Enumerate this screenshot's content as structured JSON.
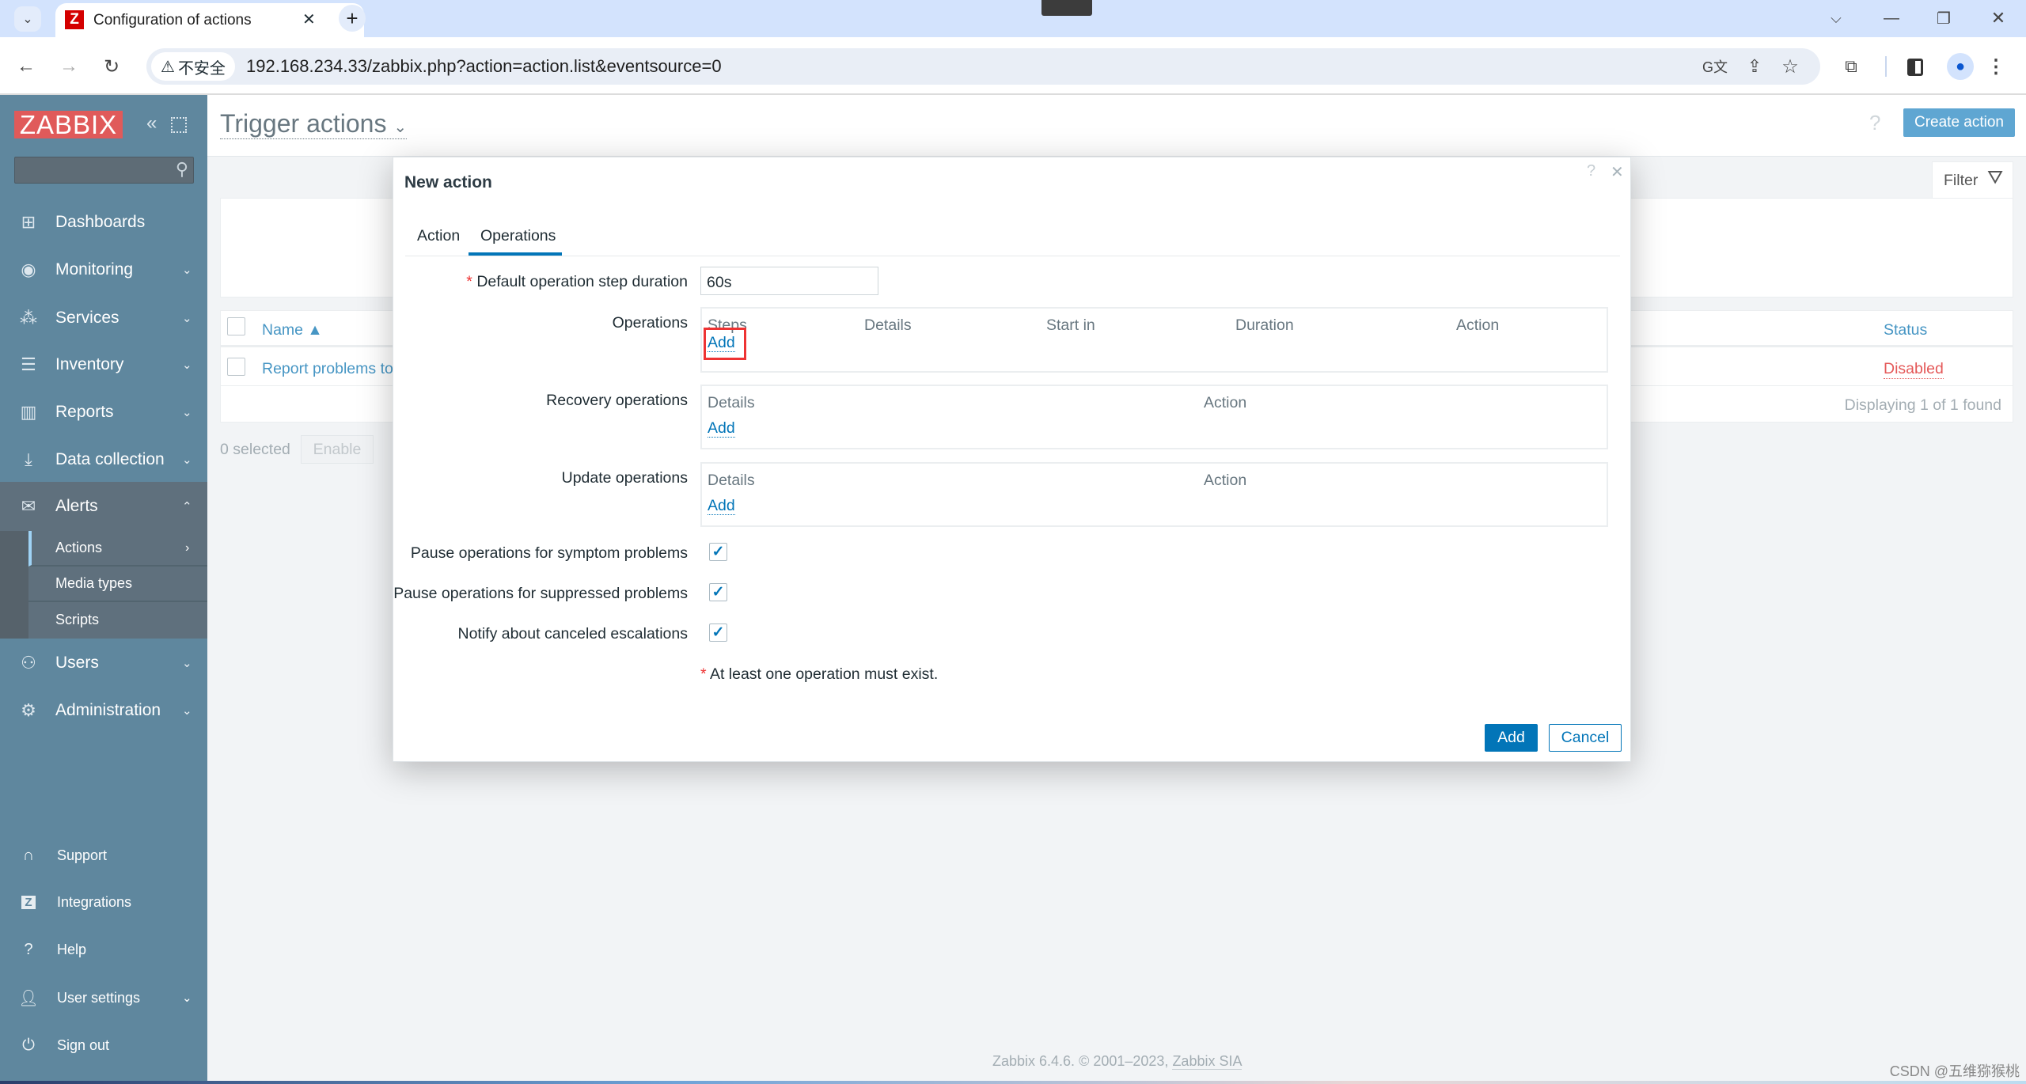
{
  "browser": {
    "tab_title": "Configuration of actions",
    "tab_favicon": "Z",
    "security_label": "不安全",
    "url": "192.168.234.33/zabbix.php?action=action.list&eventsource=0"
  },
  "sidebar": {
    "logo": "ZABBIX",
    "search_placeholder": "",
    "items": [
      {
        "label": "Dashboards",
        "icon": "dashboard-icon"
      },
      {
        "label": "Monitoring",
        "icon": "eye-icon"
      },
      {
        "label": "Services",
        "icon": "services-icon"
      },
      {
        "label": "Inventory",
        "icon": "list-icon"
      },
      {
        "label": "Reports",
        "icon": "report-icon"
      },
      {
        "label": "Data collection",
        "icon": "download-icon"
      },
      {
        "label": "Alerts",
        "icon": "envelope-icon"
      },
      {
        "label": "Users",
        "icon": "users-icon"
      },
      {
        "label": "Administration",
        "icon": "gear-icon"
      }
    ],
    "alerts_sub": [
      "Actions",
      "Media types",
      "Scripts"
    ],
    "bottom": [
      {
        "label": "Support",
        "icon": "headset-icon"
      },
      {
        "label": "Integrations",
        "icon": "zabbix-z-icon"
      },
      {
        "label": "Help",
        "icon": "help-icon"
      },
      {
        "label": "User settings",
        "icon": "user-icon"
      },
      {
        "label": "Sign out",
        "icon": "power-icon"
      }
    ]
  },
  "header": {
    "title": "Trigger actions",
    "help": "?",
    "create_button": "Create action"
  },
  "filter": {
    "label": "Filter"
  },
  "table": {
    "col_name": "Name ▲",
    "col_status": "Status",
    "rows": [
      {
        "name": "Report problems to Z",
        "status": "Disabled"
      }
    ],
    "footer": "Displaying 1 of 1 found",
    "selected": "0 selected",
    "enable_button": "Enable"
  },
  "modal": {
    "title": "New action",
    "help": "?",
    "close": "✕",
    "tabs": [
      "Action",
      "Operations"
    ],
    "active_tab": "Operations",
    "step_duration_label": "Default operation step duration",
    "step_duration_value": "60s",
    "operations_label": "Operations",
    "operations_columns": [
      "Steps",
      "Details",
      "Start in",
      "Duration",
      "Action"
    ],
    "recovery_label": "Recovery operations",
    "update_label": "Update operations",
    "sub_columns": [
      "Details",
      "Action"
    ],
    "add_link": "Add",
    "checkboxes": [
      {
        "label": "Pause operations for symptom problems",
        "checked": true
      },
      {
        "label": "Pause operations for suppressed problems",
        "checked": true
      },
      {
        "label": "Notify about canceled escalations",
        "checked": true
      }
    ],
    "required_note": "At least one operation must exist.",
    "add_button": "Add",
    "cancel_button": "Cancel"
  },
  "footer": {
    "copyright": "Zabbix 6.4.6. © 2001–2023, ",
    "company": "Zabbix SIA",
    "watermark": "CSDN @五维猕猴桃"
  },
  "colors": {
    "accent": "#0275b8",
    "sidebar": "#5f879e",
    "logo": "#e05a5a",
    "disabled": "#e45959",
    "highlight": "#e33"
  }
}
